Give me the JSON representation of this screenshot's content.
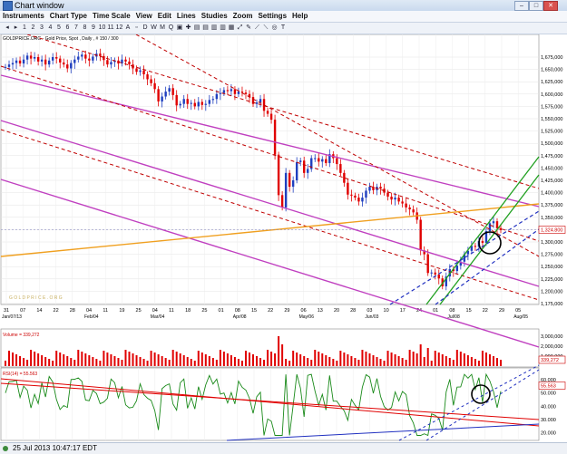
{
  "window": {
    "title": "Chart window"
  },
  "menu": [
    "Instruments",
    "Chart Type",
    "Time Scale",
    "View",
    "Edit",
    "Lines",
    "Studies",
    "Zoom",
    "Settings",
    "Help"
  ],
  "toolbar": [
    "◂",
    "▸",
    "1",
    "2",
    "3",
    "4",
    "5",
    "6",
    "7",
    "8",
    "9",
    "10",
    "11",
    "12",
    "A",
    "▫",
    "D",
    "W",
    "M",
    "Q",
    "▣",
    "✚",
    "▤",
    "▤",
    "▥",
    "▥",
    "▦",
    "⤢",
    "✎",
    "⟋",
    "⟍",
    "◎",
    "T"
  ],
  "chart": {
    "symbol_line": "GOLDPRICE.ORG - Gold Price, Spot , Daily , # 150 / 300",
    "current_price": "1,324.800",
    "watermark": "G O L D P R I C E . O R G",
    "volume_label": "Volume = 339,272",
    "rsi_label": "RSI(14) = 55.563",
    "rsi_value_box": "55.563",
    "volume_box": "339,272",
    "price_axis": [
      "1,675,000",
      "1,650,000",
      "1,625,000",
      "1,600,000",
      "1,575,000",
      "1,550,000",
      "1,525,000",
      "1,500,000",
      "1,475,000",
      "1,450,000",
      "1,425,000",
      "1,400,000",
      "1,375,000",
      "1,350,000",
      "1,325,000",
      "1,300,000",
      "1,275,000",
      "1,250,000",
      "1,225,000",
      "1,200,000",
      "1,175,000"
    ],
    "volume_axis": [
      "3,000,000",
      "2,000,000",
      "1,000,000"
    ],
    "rsi_axis": [
      "60.000",
      "50.000",
      "40.000",
      "30.000",
      "20.000"
    ],
    "date_numbers": [
      "31",
      "07",
      "14",
      "22",
      "28",
      "04",
      "11",
      "19",
      "25",
      "04",
      "11",
      "18",
      "25",
      "01",
      "08",
      "15",
      "22",
      "29",
      "06",
      "13",
      "20",
      "28",
      "03",
      "10",
      "17",
      "24",
      "01",
      "08",
      "15",
      "22",
      "29",
      "05"
    ],
    "date_labels": [
      "Jan/07/13",
      "Feb/04",
      "Mar/04",
      "Apr/08",
      "May/06",
      "Jun/03",
      "Jul/08",
      "Aug/05"
    ]
  },
  "status": {
    "text": "25 Jul 2013 10:47:17 EDT"
  },
  "colors": {
    "up": "#1f3fbf",
    "down": "#e00000",
    "channel": "#c040c0",
    "dashed": "#c00000",
    "orange": "#f0a020",
    "green": "#20a020",
    "blue_dash": "#2030c0",
    "rsi_line": "#1a8a1a"
  }
}
